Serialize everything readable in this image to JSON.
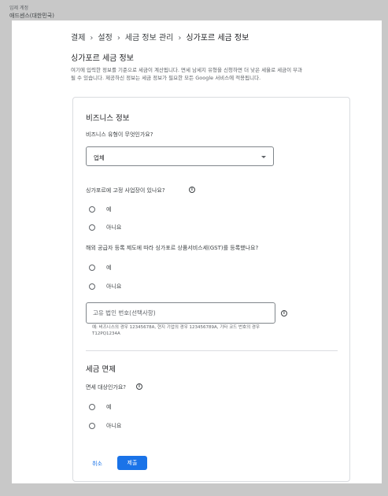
{
  "account": {
    "label": "임제 계정",
    "name": "애드센스(대한민국)"
  },
  "breadcrumb": [
    "결제",
    "설정",
    "세금 정보 관리",
    "싱가포르 세금 정보"
  ],
  "page": {
    "title": "싱가포르 세금 정보",
    "description": "여기에 입력한 정보를 기준으로 세금이 계산됩니다. 면세 남세지 유형을 신청하면 더 낮은 세율로 세금이 부과될 수 있습니다. 제공하신 정보는 세금 정보가 필요한 모든 Google 서비스에 적용됩니다."
  },
  "business": {
    "heading": "비즈니스 정보",
    "type_question": "비즈니스 유형이 무엇인가요?",
    "type_value": "업체",
    "fixed_place_question": "싱가포르에 고정 사업장이 있나요?",
    "fixed_place_options": [
      "예",
      "아니요"
    ],
    "gst_question": "해외 공급자 등록 제도에 따라 싱가포르 상품서비스세(GST)를 등록했나요?",
    "gst_options": [
      "예",
      "아니요"
    ],
    "uen_placeholder": "고유 법인 번호(선택사항)",
    "uen_hint": "예: 비즈니스의 경우 12345678A, 현지 기업의 경우 123456789A, 기타 코드 번호의 경우 T12PQ1234A"
  },
  "tax_exemption": {
    "heading": "세금 면제",
    "question": "면세 대상인가요?",
    "options": [
      "예",
      "아니요"
    ]
  },
  "actions": {
    "cancel_label": "취소",
    "submit_label": "제출"
  },
  "colors": {
    "accent": "#1a73e8",
    "frame": "#c8c8c8",
    "border": "#dadce0"
  }
}
